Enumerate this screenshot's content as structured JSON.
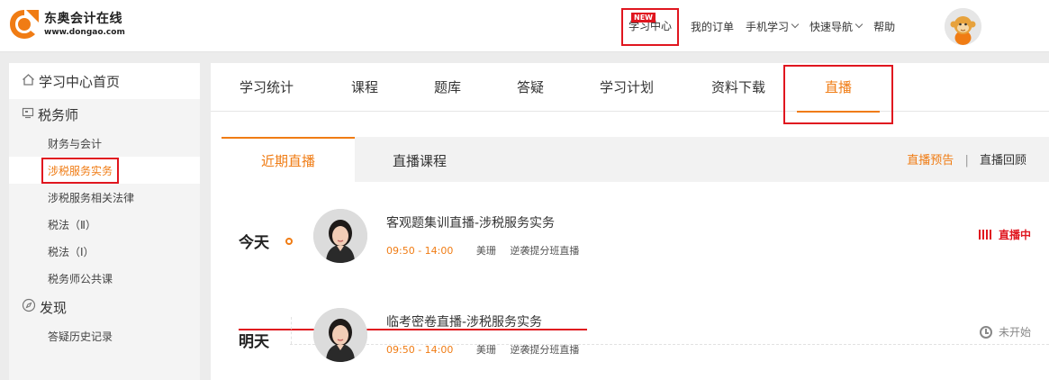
{
  "header": {
    "logo_cn": "东奥会计在线",
    "logo_url": "www.dongao.com",
    "nav": {
      "study_center": "学习中心",
      "new_badge": "NEW",
      "my_orders": "我的订单",
      "mobile_study": "手机学习",
      "quick_nav": "快速导航",
      "help": "帮助"
    }
  },
  "sidebar": {
    "home": "学习中心首页",
    "section_tax": "税务师",
    "items": [
      "财务与会计",
      "涉税服务实务",
      "涉税服务相关法律",
      "税法（Ⅱ）",
      "税法（Ⅰ）",
      "税务师公共课"
    ],
    "active_item": "涉税服务实务",
    "section_discover": "发现",
    "discover_items": [
      "答疑历史记录"
    ]
  },
  "main": {
    "tabs": [
      "学习统计",
      "课程",
      "题库",
      "答疑",
      "学习计划",
      "资料下载"
    ],
    "active_tab": "直播",
    "subtabs": {
      "recent": "近期直播",
      "courses": "直播课程"
    },
    "filters": {
      "preview": "直播预告",
      "separator": "|",
      "replay": "直播回顾"
    },
    "lives": [
      {
        "day": "今天",
        "title": "客观题集训直播-涉税服务实务",
        "time": "09:50 - 14:00",
        "teacher": "美珊",
        "class": "逆袭提分班直播",
        "status": "直播中",
        "status_icon": "signal-bars-icon"
      },
      {
        "day": "明天",
        "title": "临考密卷直播-涉税服务实务",
        "time": "09:50 - 14:00",
        "teacher": "美珊",
        "class": "逆袭提分班直播",
        "status": "未开始",
        "status_icon": "clock-icon"
      }
    ]
  },
  "colors": {
    "accent": "#f07c14",
    "highlight_red": "#e0161f"
  }
}
